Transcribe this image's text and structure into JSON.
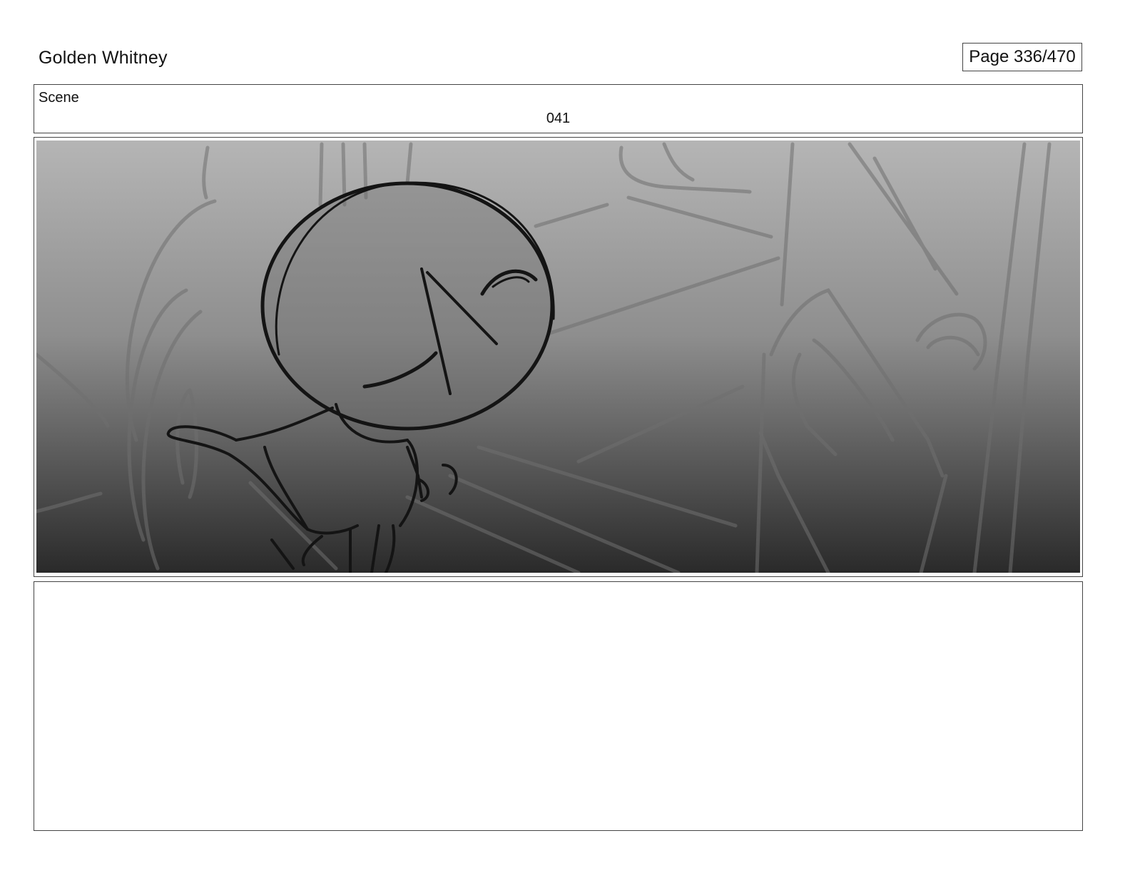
{
  "header": {
    "project_title": "Golden Whitney",
    "page_indicator": "Page 336/470"
  },
  "scene": {
    "label": "Scene",
    "number": "041"
  },
  "panel": {
    "image_name": "storyboard-sketch",
    "gradient_top": "#b5b5b5",
    "gradient_bottom": "#2a2a2a"
  },
  "notes": {
    "text": ""
  }
}
